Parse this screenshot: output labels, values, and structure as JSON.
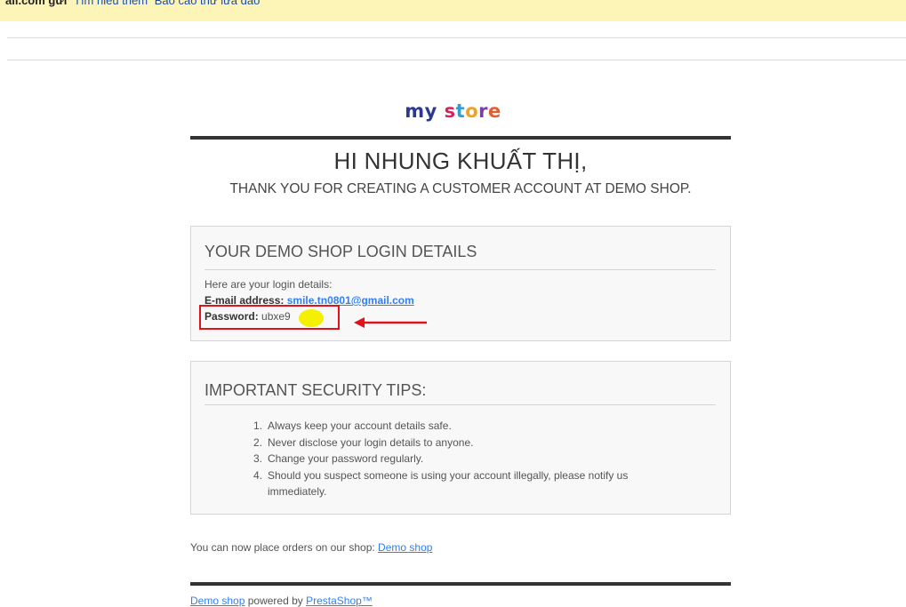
{
  "warning_bar": {
    "sender": "ail.com gửi",
    "learn_more": "Tìm hiểu thêm",
    "report": "Báo cáo thư lừa đảo"
  },
  "logo": {
    "word1": "my",
    "word2": "store"
  },
  "greeting": "HI NHUNG KHUẤT THỊ,",
  "subgreeting": "THANK YOU FOR CREATING A CUSTOMER ACCOUNT AT DEMO SHOP.",
  "login_box": {
    "title": "YOUR DEMO SHOP LOGIN DETAILS",
    "intro": "Here are your login details:",
    "email_label": "E-mail address:",
    "email_value": "smile.tn0801@gmail.com",
    "password_label": "Password:",
    "password_value": "ubxe9"
  },
  "security_box": {
    "title": "IMPORTANT SECURITY TIPS:",
    "tips": [
      {
        "num": "1.",
        "text": "Always keep your account details safe."
      },
      {
        "num": "2.",
        "text": "Never disclose your login details to anyone."
      },
      {
        "num": "3.",
        "text": "Change your password regularly."
      },
      {
        "num": "4.",
        "text": "Should you suspect someone is using your account illegally, please notify us immediately."
      }
    ]
  },
  "footer": {
    "order_text": "You can now place orders on our shop:",
    "order_link": "Demo shop",
    "credit_link1": "Demo shop",
    "credit_mid": "powered by",
    "credit_link2": "PrestaShop™"
  },
  "colors": {
    "warning_bg": "#fdf4b7",
    "link": "#337ff1",
    "annotation_red": "#e0121c",
    "box_bg": "#f8f8f8"
  }
}
